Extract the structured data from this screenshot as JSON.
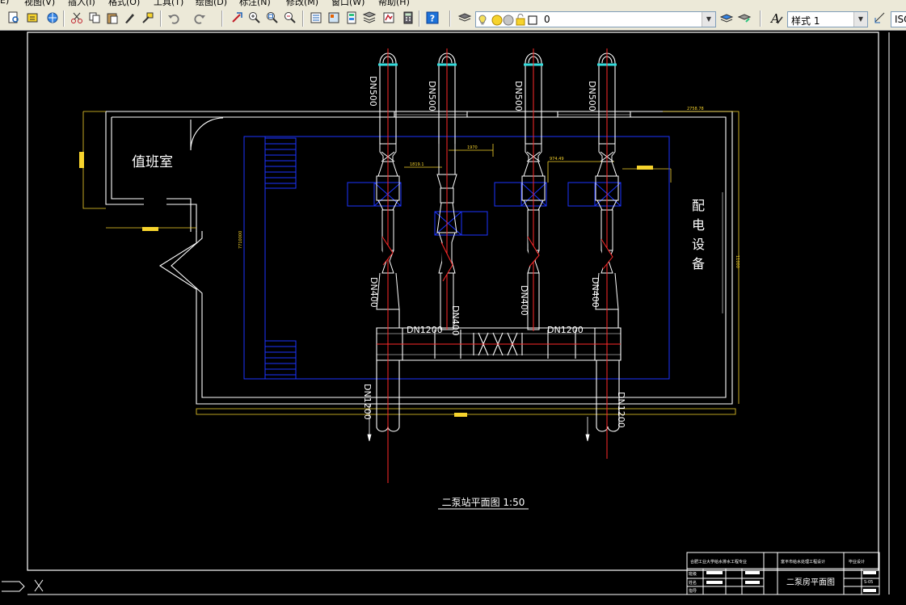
{
  "menu": {
    "items": [
      "E)",
      "视图(V)",
      "插入(I)",
      "格式(O)",
      "工具(T)",
      "绘图(D)",
      "标注(N)",
      "修改(M)",
      "窗口(W)",
      "帮助(H)"
    ]
  },
  "toolbar": {
    "layer_value": "0",
    "style_value": "样式 1",
    "iso_value": "ISO"
  },
  "drawing": {
    "room_left": "值班室",
    "room_right": "配电设备",
    "pipe_labels": {
      "dn500": "DN500",
      "dn400": "DN400",
      "dn1200": "DN1200"
    },
    "small_dims": {
      "d1": "1819.1",
      "d2": "1970",
      "d3": "974.49",
      "d4": "2758.78",
      "d5": "7710000",
      "d6": "11000"
    },
    "caption": "二泵站平面图 1:50"
  },
  "title_block": {
    "school": "合肥工业大学给水排水工程专业",
    "project": "富平市给水处理工程设计",
    "sheet_name": "二泵房平面图",
    "design_label": "毕业设计",
    "row_labels": [
      "班级",
      "姓名",
      "指导"
    ],
    "code": "S-05"
  }
}
